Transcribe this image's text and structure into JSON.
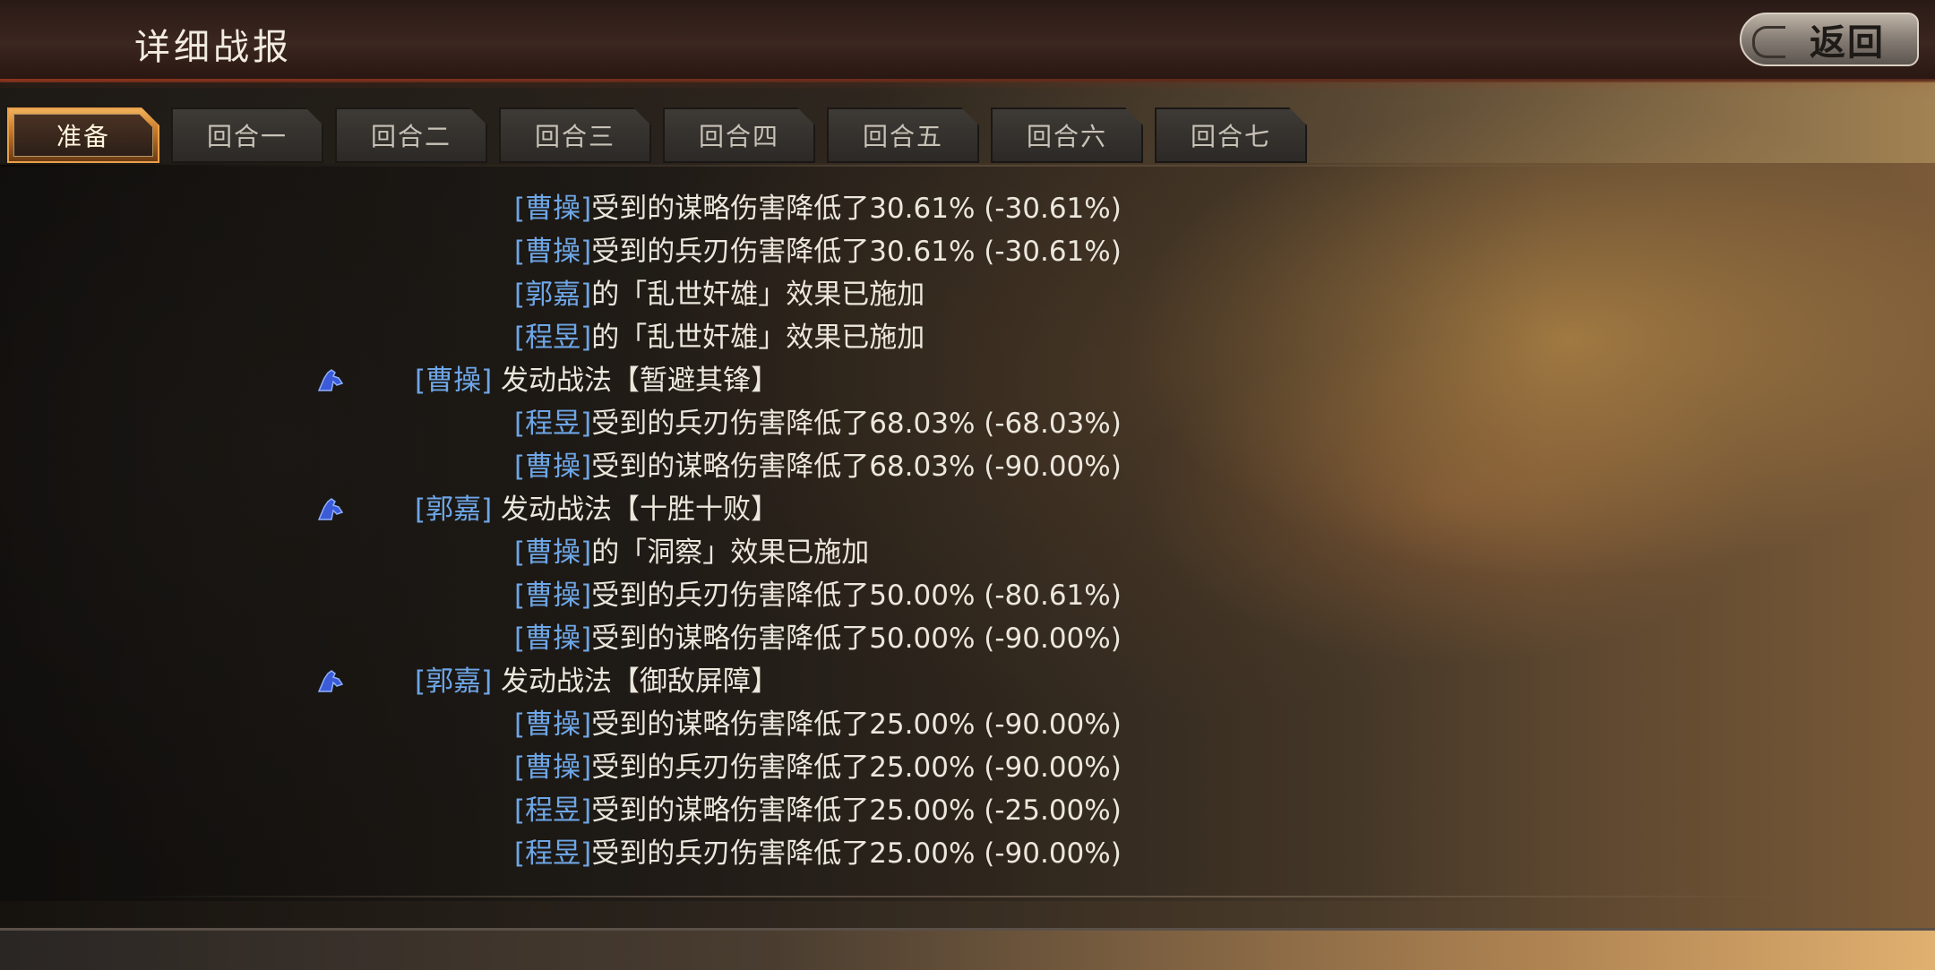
{
  "header": {
    "title": "详细战报",
    "back_label": "返回"
  },
  "tabs": [
    {
      "label": "准备",
      "active": true
    },
    {
      "label": "回合一",
      "active": false
    },
    {
      "label": "回合二",
      "active": false
    },
    {
      "label": "回合三",
      "active": false
    },
    {
      "label": "回合四",
      "active": false
    },
    {
      "label": "回合五",
      "active": false
    },
    {
      "label": "回合六",
      "active": false
    },
    {
      "label": "回合七",
      "active": false
    }
  ],
  "log": [
    {
      "type": "effect",
      "name": "[曹操]",
      "text": "受到的谋略伤害降低了30.61% (-30.61%)"
    },
    {
      "type": "effect",
      "name": "[曹操]",
      "text": "受到的兵刃伤害降低了30.61% (-30.61%)"
    },
    {
      "type": "effect",
      "name": "[郭嘉]",
      "text": "的「乱世奸雄」效果已施加"
    },
    {
      "type": "effect",
      "name": "[程昱]",
      "text": "的「乱世奸雄」效果已施加"
    },
    {
      "type": "skill",
      "name": "[曹操]",
      "text": " 发动战法【暂避其锋】",
      "icon": "cavalry-icon"
    },
    {
      "type": "effect",
      "name": "[程昱]",
      "text": "受到的兵刃伤害降低了68.03% (-68.03%)"
    },
    {
      "type": "effect",
      "name": "[曹操]",
      "text": "受到的谋略伤害降低了68.03% (-90.00%)"
    },
    {
      "type": "skill",
      "name": "[郭嘉]",
      "text": " 发动战法【十胜十败】",
      "icon": "cavalry-icon"
    },
    {
      "type": "effect",
      "name": "[曹操]",
      "text": "的「洞察」效果已施加"
    },
    {
      "type": "effect",
      "name": "[曹操]",
      "text": "受到的兵刃伤害降低了50.00% (-80.61%)"
    },
    {
      "type": "effect",
      "name": "[曹操]",
      "text": "受到的谋略伤害降低了50.00% (-90.00%)"
    },
    {
      "type": "skill",
      "name": "[郭嘉]",
      "text": " 发动战法【御敌屏障】",
      "icon": "cavalry-icon"
    },
    {
      "type": "effect",
      "name": "[曹操]",
      "text": "受到的谋略伤害降低了25.00% (-90.00%)"
    },
    {
      "type": "effect",
      "name": "[曹操]",
      "text": "受到的兵刃伤害降低了25.00% (-90.00%)"
    },
    {
      "type": "effect",
      "name": "[程昱]",
      "text": "受到的谋略伤害降低了25.00% (-25.00%)"
    },
    {
      "type": "effect",
      "name": "[程昱]",
      "text": "受到的兵刃伤害降低了25.00% (-90.00%)"
    }
  ],
  "colors": {
    "name": "#6ea6e6",
    "text": "#ece7dc",
    "active_tab": "#e8a04a",
    "icon": "#3b5bd8"
  }
}
